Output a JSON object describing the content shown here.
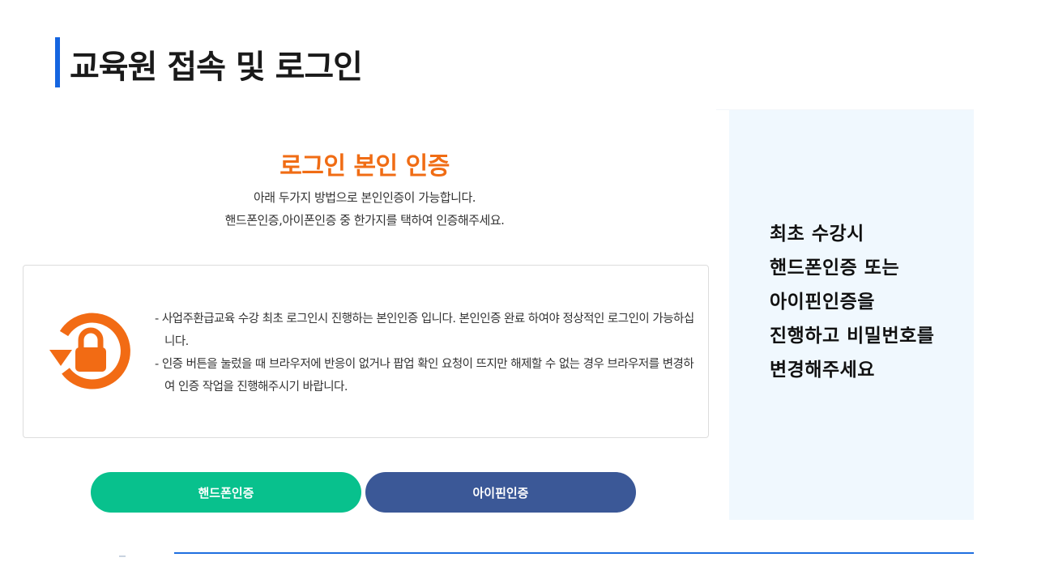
{
  "slide": {
    "title": "교육원 접속 및 로그인",
    "accent_color": "#1565e0"
  },
  "auth": {
    "heading": "로그인 본인 인증",
    "heading_color": "#f06c14",
    "subtitle_line1": "아래 두가지 방법으로 본인인증이 가능합니다.",
    "subtitle_line2": "핸드폰인증,아이폰인증 중 한가지를 택하여 인증해주세요."
  },
  "notice": {
    "icon": "lock-refresh-icon",
    "icon_color": "#f26b14",
    "items": [
      "- 사업주환급교육 수강 최초 로그인시 진행하는 본인인증 입니다. 본인인증 완료 하여야 정상적인 로그인이 가능하십니다.",
      "- 인증 버튼을 눌렀을 때 브라우저에 반응이 없거나 팝업 확인 요청이 뜨지만 해제할 수 없는 경우 브라우저를 변경하여 인증 작업을 진행해주시기 바랍니다."
    ]
  },
  "buttons": {
    "phone_label": "핸드폰인증",
    "phone_color": "#08c18d",
    "ipin_label": "아이핀인증",
    "ipin_color": "#3b5897"
  },
  "side_panel": {
    "background": "#f0f8fe",
    "lines": [
      "최초 수강시",
      "핸드폰인증 또는",
      "아이핀인증을",
      "진행하고 비밀번호를",
      "변경해주세요"
    ]
  }
}
